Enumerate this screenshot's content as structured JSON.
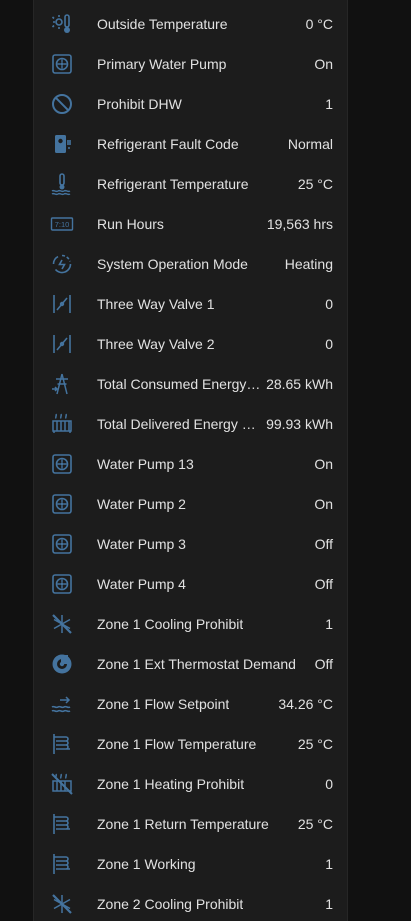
{
  "colors": {
    "background": "#111111",
    "card": "#1c1c1c",
    "icon": "#44739e",
    "text": "#e1e1e1"
  },
  "entities": [
    {
      "icon": "thermometer-sun-icon",
      "name": "Outside Temperature",
      "value": "0 °C"
    },
    {
      "icon": "pump-icon",
      "name": "Primary Water Pump",
      "value": "On"
    },
    {
      "icon": "cancel-icon",
      "name": "Prohibit DHW",
      "value": "1"
    },
    {
      "icon": "hvac-fault-icon",
      "name": "Refrigerant Fault Code",
      "value": "Normal"
    },
    {
      "icon": "thermometer-water-icon",
      "name": "Refrigerant Temperature",
      "value": "25 °C"
    },
    {
      "icon": "counter-icon",
      "name": "Run Hours",
      "value": "19,563 hrs"
    },
    {
      "icon": "sync-circle-icon",
      "name": "System Operation Mode",
      "value": "Heating"
    },
    {
      "icon": "valve-icon",
      "name": "Three Way Valve 1",
      "value": "0"
    },
    {
      "icon": "valve-icon",
      "name": "Three Way Valve 2",
      "value": "0"
    },
    {
      "icon": "transmission-tower-import-icon",
      "name": "Total Consumed Energy…",
      "value": "28.65 kWh"
    },
    {
      "icon": "radiator-icon",
      "name": "Total Delivered Energy …",
      "value": "99.93 kWh"
    },
    {
      "icon": "pump-icon",
      "name": "Water Pump 13",
      "value": "On"
    },
    {
      "icon": "pump-icon",
      "name": "Water Pump 2",
      "value": "On"
    },
    {
      "icon": "pump-icon",
      "name": "Water Pump 3",
      "value": "Off"
    },
    {
      "icon": "pump-icon",
      "name": "Water Pump 4",
      "value": "Off"
    },
    {
      "icon": "snowflake-off-icon",
      "name": "Zone 1 Cooling Prohibit",
      "value": "1"
    },
    {
      "icon": "thermostat-icon",
      "name": "Zone 1 Ext Thermostat Demand",
      "value": "Off"
    },
    {
      "icon": "waves-arrow-right-icon",
      "name": "Zone 1 Flow Setpoint",
      "value": "34.26 °C"
    },
    {
      "icon": "heating-coil-icon",
      "name": "Zone 1 Flow Temperature",
      "value": "25 °C"
    },
    {
      "icon": "radiator-off-icon",
      "name": "Zone 1 Heating Prohibit",
      "value": "0"
    },
    {
      "icon": "heating-coil-icon",
      "name": "Zone 1 Return Temperature",
      "value": "25 °C"
    },
    {
      "icon": "heating-coil-icon",
      "name": "Zone 1 Working",
      "value": "1"
    },
    {
      "icon": "snowflake-off-icon",
      "name": "Zone 2 Cooling Prohibit",
      "value": "1"
    }
  ]
}
